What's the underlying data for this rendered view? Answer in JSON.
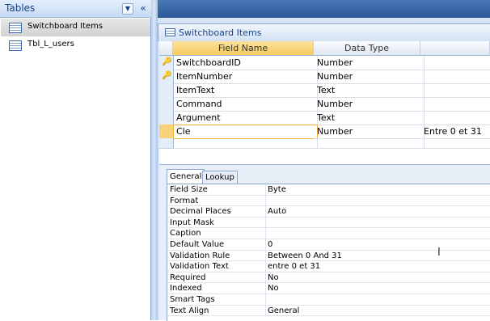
{
  "nav": {
    "title": "Tables",
    "dropdown_glyph": "▼",
    "collapse_glyph": "«",
    "items": [
      {
        "label": "Switchboard Items",
        "icon": "table-icon",
        "selected": true
      },
      {
        "label": "Tbl_L_users",
        "icon": "table-icon",
        "selected": false
      }
    ]
  },
  "document": {
    "tab_title": "Switchboard Items",
    "grid": {
      "headers": {
        "field_name": "Field Name",
        "data_type": "Data Type",
        "description": ""
      },
      "rows": [
        {
          "field": "SwitchboardID",
          "type": "Number",
          "description": "",
          "key": true
        },
        {
          "field": "ItemNumber",
          "type": "Number",
          "description": "",
          "key": true
        },
        {
          "field": "ItemText",
          "type": "Text",
          "description": "",
          "key": false
        },
        {
          "field": "Command",
          "type": "Number",
          "description": "",
          "key": false
        },
        {
          "field": "Argument",
          "type": "Text",
          "description": "",
          "key": false
        },
        {
          "field": "Cle",
          "type": "Number",
          "description": "Entre 0 et 31",
          "key": false,
          "current": true
        },
        {
          "field": "",
          "type": "",
          "description": "",
          "key": false
        }
      ]
    }
  },
  "properties": {
    "tabs": [
      "General",
      "Lookup"
    ],
    "active_tab": "General",
    "rows": [
      {
        "label": "Field Size",
        "value": "Byte"
      },
      {
        "label": "Format",
        "value": ""
      },
      {
        "label": "Decimal Places",
        "value": "Auto"
      },
      {
        "label": "Input Mask",
        "value": ""
      },
      {
        "label": "Caption",
        "value": ""
      },
      {
        "label": "Default Value",
        "value": "0"
      },
      {
        "label": "Validation Rule",
        "value": "Between 0 And 31"
      },
      {
        "label": "Validation Text",
        "value": "entre 0 et 31"
      },
      {
        "label": "Required",
        "value": "No"
      },
      {
        "label": "Indexed",
        "value": "No"
      },
      {
        "label": "Smart Tags",
        "value": ""
      },
      {
        "label": "Text Align",
        "value": "General"
      }
    ]
  },
  "colors": {
    "accent_header": "#f7c95f",
    "nav_text": "#15428b",
    "frame_blue": "#2b5897"
  }
}
